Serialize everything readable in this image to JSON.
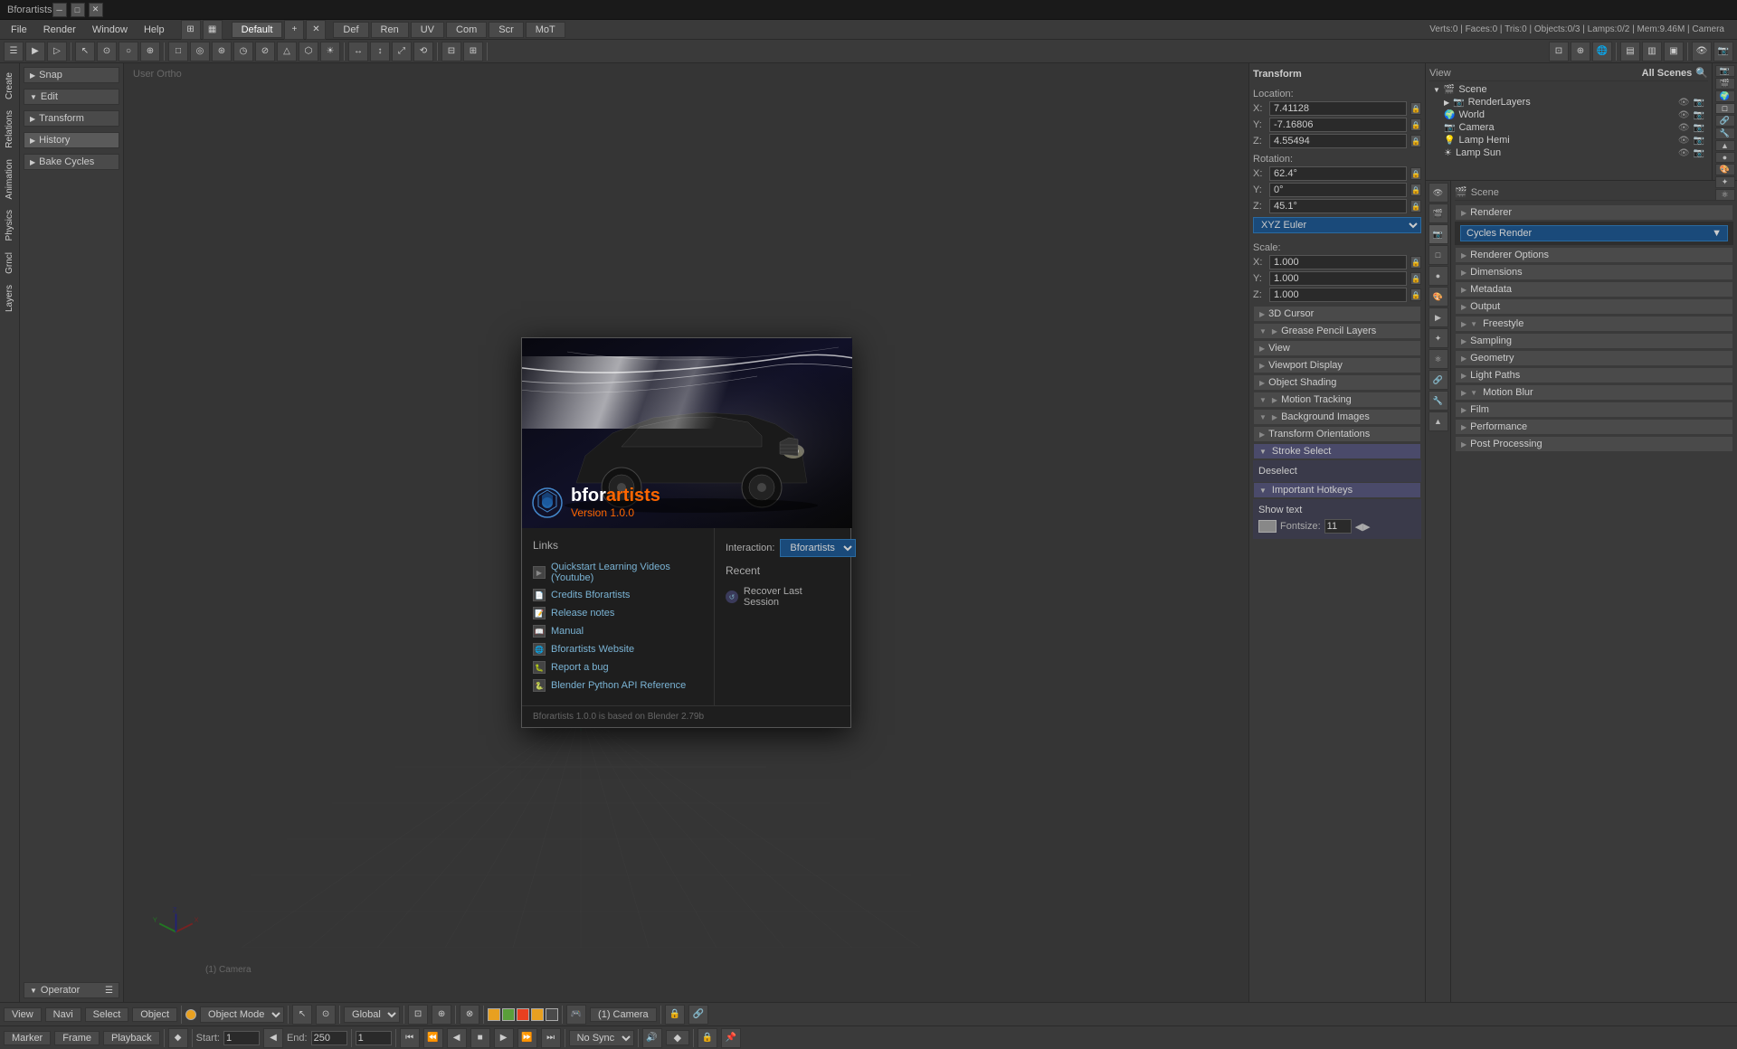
{
  "titlebar": {
    "title": "Bforartists",
    "min_btn": "─",
    "max_btn": "□",
    "close_btn": "✕"
  },
  "menubar": {
    "items": [
      "File",
      "Render",
      "Window",
      "Help"
    ]
  },
  "workspace": {
    "profile_icon": "⊞",
    "default_label": "Default",
    "close_icon": "✕",
    "tabs": [
      "Def",
      "Ren",
      "UV",
      "Com",
      "Scr",
      "MoT"
    ],
    "info": "Verts:0 | Faces:0 | Tris:0 | Objects:0/3 | Lamps:0/2 | Mem:9.46M | Camera"
  },
  "viewport": {
    "label": "User Ortho",
    "camera_label": "(1) Camera"
  },
  "left_panel": {
    "snap_label": "Snap",
    "edit_label": "Edit",
    "edit_expanded": true,
    "transform_label": "Transform",
    "history_label": "History",
    "bake_label": "Bake Cycles"
  },
  "left_sidebar": {
    "tabs": [
      "Create",
      "Relations",
      "Animation",
      "Physics",
      "Grncl",
      "Layers"
    ]
  },
  "transform_panel": {
    "title": "Transform",
    "location_label": "Location:",
    "x_val": "7.41128",
    "y_val": "-7.16806",
    "z_val": "4.55494",
    "rotation_label": "Rotation:",
    "rx_val": "62.4°",
    "ry_val": "0°",
    "rz_val": "45.1°",
    "euler_label": "XYZ Euler",
    "scale_label": "Scale:",
    "sx_val": "1.000",
    "sy_val": "1.000",
    "sz_val": "1.000",
    "cursor_label": "3D Cursor",
    "grease_label": "Grease Pencil Layers",
    "view_label": "View",
    "viewport_display_label": "Viewport Display",
    "object_shading_label": "Object Shading",
    "motion_tracking_label": "Motion Tracking",
    "background_images_label": "Background Images",
    "transform_orientations_label": "Transform Orientations",
    "stroke_select_label": "Stroke Select",
    "important_hotkeys_label": "Important Hotkeys",
    "show_text_label": "Show text",
    "fontsize_label": "Fontsize:",
    "fontsize_val": "11",
    "deselect_label": "Deselect"
  },
  "right_panel": {
    "scene_label": "Scene",
    "render_layers_label": "RenderLayers",
    "world_label": "World",
    "camera_label": "Camera",
    "lamp_hemi_label": "Lamp Hemi",
    "lamp_sun_label": "Lamp Sun",
    "view_label": "View",
    "all_scenes_label": "All Scenes",
    "search_placeholder": "🔍",
    "renderer_label": "Renderer",
    "cycles_render_label": "Cycles Render",
    "renderer_options_label": "Renderer Options",
    "dimensions_label": "Dimensions",
    "metadata_label": "Metadata",
    "output_label": "Output",
    "freestyle_label": "Freestyle",
    "sampling_label": "Sampling",
    "geometry_label": "Geometry",
    "light_paths_label": "Light Paths",
    "motion_blur_label": "Motion Blur",
    "film_label": "Film",
    "performance_label": "Performance",
    "post_processing_label": "Post Processing"
  },
  "splash": {
    "logo_name_start": "bfor",
    "logo_name_end": "artists",
    "version_label": "Version 1.0.0",
    "links_title": "Links",
    "links": [
      "Quickstart Learning Videos (Youtube)",
      "Credits Bforartists",
      "Release notes",
      "Manual",
      "Bforartists Website",
      "Report a bug",
      "Blender Python API Reference"
    ],
    "recent_title": "Recent",
    "interaction_label": "Interaction:",
    "interaction_value": "Bforartists",
    "recover_label": "Recover Last Session",
    "footer_text": "Bforartists 1.0.0 is based on Blender 2.79b"
  },
  "bottom_bar": {
    "view_label": "View",
    "navi_label": "Navi",
    "select_label": "Select",
    "object_label": "Object",
    "mode_label": "Object Mode",
    "global_label": "Global",
    "camera_sel_label": "(1) Camera"
  },
  "timeline": {
    "marker_label": "Marker",
    "frame_label": "Frame",
    "playback_label": "Playback",
    "start_label": "Start:",
    "start_val": "1",
    "end_label": "End:",
    "end_val": "250",
    "current_frame": "1",
    "sync_label": "No Sync"
  }
}
